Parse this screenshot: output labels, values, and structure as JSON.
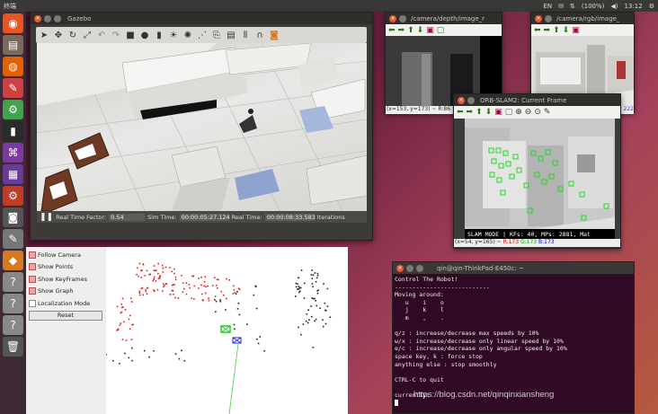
{
  "topbar": {
    "title": "终端",
    "indicators": [
      "EN",
      "✉",
      "⇅",
      "🔊"
    ],
    "battery": "(100%)",
    "volume": "◀)",
    "time": "13:12",
    "gear": "⚙"
  },
  "launcher": {
    "items": [
      {
        "name": "ubuntu-dash",
        "glyph": "◉",
        "color": "#e95420"
      },
      {
        "name": "files",
        "glyph": "▤",
        "color": "#7a6a5a"
      },
      {
        "name": "firefox",
        "glyph": "◍",
        "color": "#e66000"
      },
      {
        "name": "settings-app",
        "glyph": "✎",
        "color": "#d04040"
      },
      {
        "name": "qt-creator",
        "glyph": "⚙",
        "color": "#41a44b"
      },
      {
        "name": "terminal",
        "glyph": "▮",
        "color": "#2b2b2b"
      },
      {
        "name": "tool-a",
        "glyph": "⌘",
        "color": "#7a3aa0"
      },
      {
        "name": "tool-b",
        "glyph": "▦",
        "color": "#6a3a9a"
      },
      {
        "name": "system-settings",
        "glyph": "⚙",
        "color": "#c23b22"
      },
      {
        "name": "camera",
        "glyph": "◙",
        "color": "#555"
      },
      {
        "name": "text-editor",
        "glyph": "✎",
        "color": "#777"
      },
      {
        "name": "rviz",
        "glyph": "◆",
        "color": "#d77a1f"
      },
      {
        "name": "unknown-1",
        "glyph": "?",
        "color": "#888"
      },
      {
        "name": "unknown-2",
        "glyph": "?",
        "color": "#888"
      },
      {
        "name": "unknown-3",
        "glyph": "?",
        "color": "#888"
      },
      {
        "name": "trash",
        "glyph": "🗑",
        "color": "#555"
      }
    ]
  },
  "gazebo": {
    "title": "Gazebo",
    "status": {
      "real_time_factor_label": "Real Time Factor:",
      "real_time_factor": "0.54",
      "sim_time_label": "Sim Time:",
      "sim_time": "00:00:05:27.124",
      "real_time_label": "Real Time:",
      "real_time": "00:00:08:33.583",
      "iterations_label": "Iterations"
    }
  },
  "depth_win": {
    "title": "/camera/depth/image_r",
    "coord": "(x=153, y=173) ~ R:86"
  },
  "rgb_win": {
    "title": "/camera/rgb/image_",
    "coord": "222"
  },
  "orb_win": {
    "title": "ORB-SLAM2: Current Frame",
    "coord": "(x=54, y=165) ~ ",
    "r": "R:173",
    "g": "G:173",
    "b": "B:173",
    "overlay": "SLAM MODE | KFs: 40, MPs: 2881, Mat"
  },
  "panel": {
    "checks": [
      {
        "label": "Follow Camera",
        "on": true
      },
      {
        "label": "Show Points",
        "on": true
      },
      {
        "label": "Show KeyFrames",
        "on": true
      },
      {
        "label": "Show Graph",
        "on": true
      },
      {
        "label": "Localization Mode",
        "on": false
      }
    ],
    "reset": "Reset"
  },
  "terminal": {
    "title": "qin@qin-ThinkPad-E450c: ~",
    "lines": [
      "Control The Robot!",
      "---------------------------",
      "Moving around:",
      "   u    i    o",
      "   j    k    l",
      "   m    ,    .",
      "",
      "q/z : increase/decrease max speeds by 10%",
      "w/x : increase/decrease only linear speed by 10%",
      "e/c : increase/decrease only angular speed by 10%",
      "space key, k : force stop",
      "anything else : stop smoothly",
      "",
      "CTRL-C to quit",
      "",
      "currently:"
    ]
  },
  "watermark": "https://blog.csdn.net/qinqinxiansheng"
}
